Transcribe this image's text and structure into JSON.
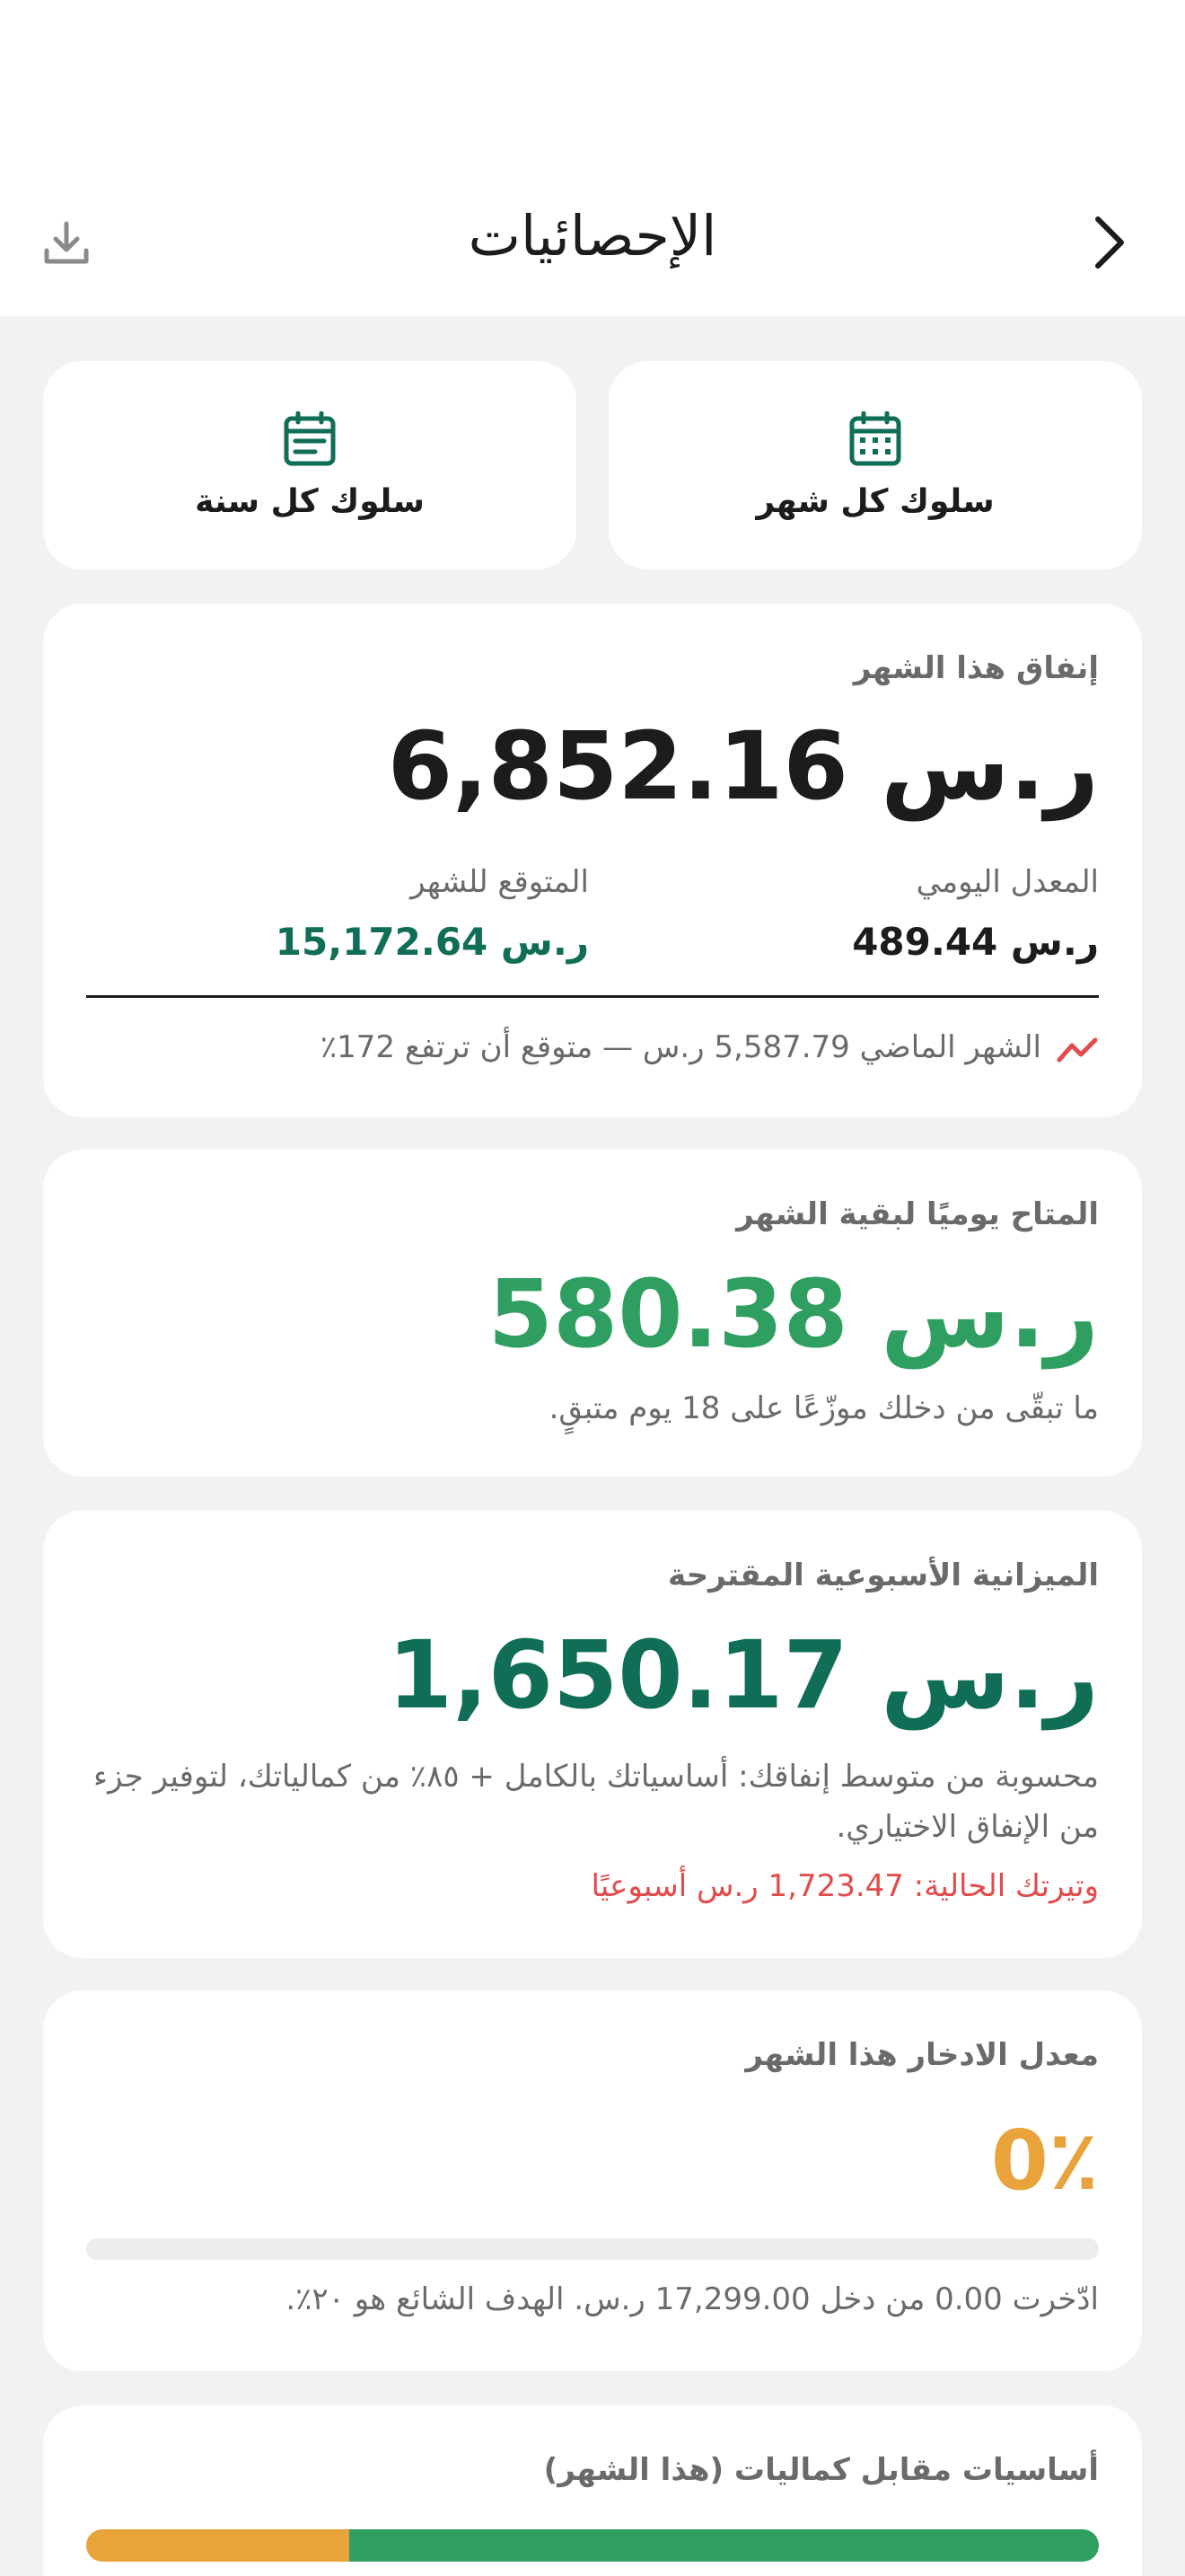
{
  "header": {
    "title": "الإحصائيات"
  },
  "tiles": {
    "monthly_label": "سلوك كل شهر",
    "yearly_label": "سلوك كل سنة"
  },
  "spending": {
    "title": "إنفاق هذا الشهر",
    "amount": "6,852.16 ر.س",
    "daily_label": "المعدل اليومي",
    "daily_value": "489.44 ر.س",
    "forecast_label": "المتوقع للشهر",
    "forecast_value": "15,172.64 ر.س",
    "comparison": "الشهر الماضي 5,587.79 ر.س — متوقع أن ترتفع 172٪"
  },
  "available": {
    "title": "المتاح يوميًا لبقية الشهر",
    "amount": "580.38 ر.س",
    "note": "ما تبقّى من دخلك موزّعًا على 18 يوم متبقٍ."
  },
  "weekly": {
    "title": "الميزانية الأسبوعية المقترحة",
    "amount": "1,650.17 ر.س",
    "note": "محسوبة من متوسط إنفاقك: أساسياتك بالكامل + ٨٥٪ من كمالياتك، لتوفير جزء من الإنفاق الاختياري.",
    "current_rate": "وتيرتك الحالية: 1,723.47 ر.س أسبوعيًا"
  },
  "savings": {
    "title": "معدل الادخار هذا الشهر",
    "rate": "0٪",
    "progress_percent": 0,
    "note": "ادّخرت 0.00 من دخل 17,299.00 ر.س. الهدف الشائع هو ٢٠٪."
  },
  "essentials": {
    "title": "أساسيات مقابل كماليات (هذا الشهر)",
    "essentials_percent": 74,
    "luxuries_percent": 26
  },
  "colors": {
    "brand_green": "#0f6e55",
    "bright_green": "#2f9e61",
    "orange": "#e8a33a",
    "red": "#e24b4b"
  }
}
